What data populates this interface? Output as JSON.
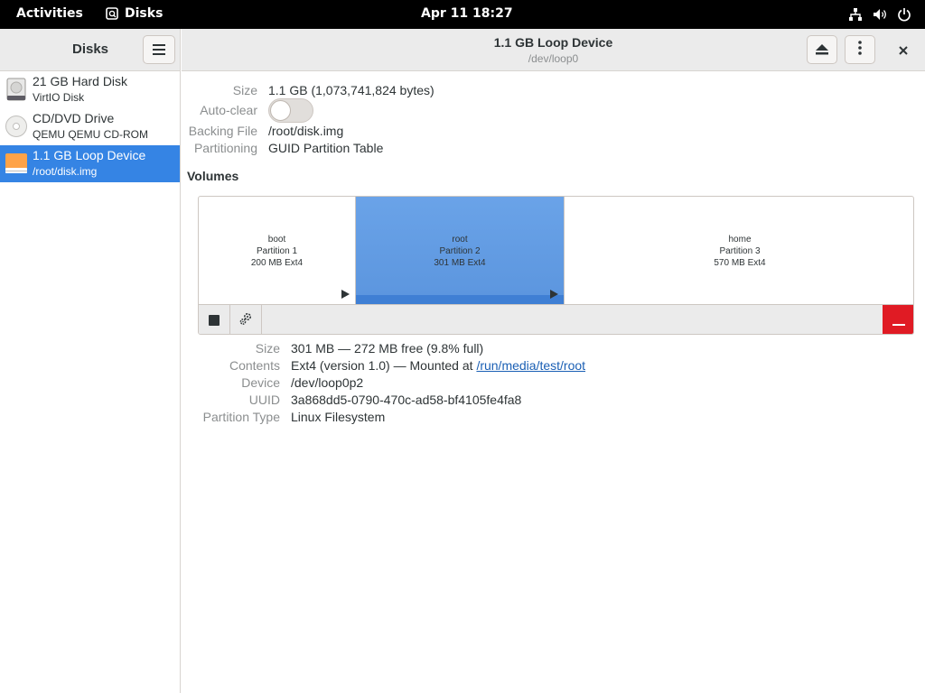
{
  "topbar": {
    "activities": "Activities",
    "app_name": "Disks",
    "clock": "Apr 11  18:27"
  },
  "sidebar": {
    "title": "Disks",
    "disks": [
      {
        "name": "21 GB Hard Disk",
        "subtitle": "VirtIO Disk",
        "icon": "hard-disk-icon"
      },
      {
        "name": "CD/DVD Drive",
        "subtitle": "QEMU QEMU CD-ROM",
        "icon": "optical-disc-icon"
      },
      {
        "name": "1.1 GB Loop Device",
        "subtitle": "/root/disk.img",
        "icon": "loop-device-icon",
        "selected": true
      }
    ]
  },
  "header": {
    "title": "1.1 GB Loop Device",
    "subtitle": "/dev/loop0"
  },
  "device_info": {
    "size_label": "Size",
    "size_value": "1.1 GB (1,073,741,824 bytes)",
    "autoclear_label": "Auto-clear",
    "autoclear_on": false,
    "backing_label": "Backing File",
    "backing_value": "/root/disk.img",
    "partitioning_label": "Partitioning",
    "partitioning_value": "GUID Partition Table"
  },
  "volumes": {
    "heading": "Volumes",
    "partitions": [
      {
        "name": "boot",
        "number": "Partition 1",
        "detail": "200 MB Ext4"
      },
      {
        "name": "root",
        "number": "Partition 2",
        "detail": "301 MB Ext4",
        "selected": true
      },
      {
        "name": "home",
        "number": "Partition 3",
        "detail": "570 MB Ext4"
      }
    ]
  },
  "partition_info": {
    "size_label": "Size",
    "size_value": "301 MB — 272 MB free (9.8% full)",
    "contents_label": "Contents",
    "contents_prefix": "Ext4 (version 1.0) — Mounted at ",
    "contents_link": "/run/media/test/root",
    "device_label": "Device",
    "device_value": "/dev/loop0p2",
    "uuid_label": "UUID",
    "uuid_value": "3a868dd5-0790-470c-ad58-bf4105fe4fa8",
    "type_label": "Partition Type",
    "type_value": "Linux Filesystem"
  },
  "colors": {
    "accent": "#3584e4",
    "selected_partition": "#5e9ae4",
    "destructive": "#e01b24"
  }
}
